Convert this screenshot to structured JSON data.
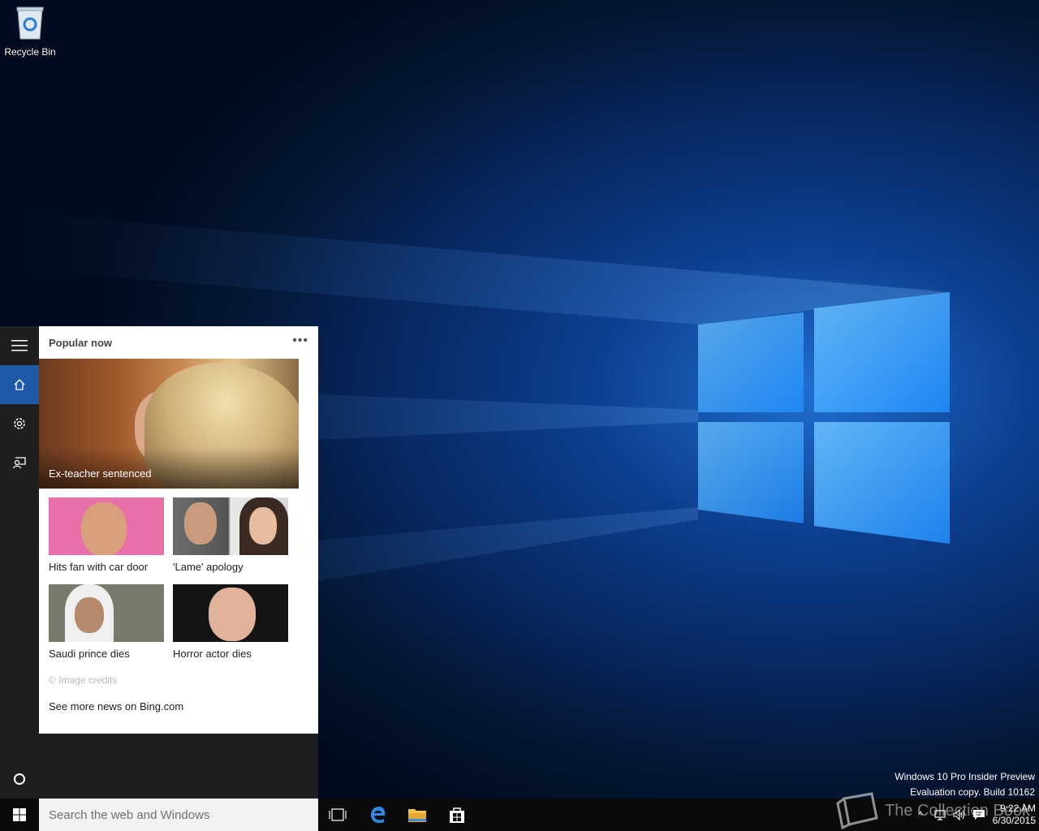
{
  "desktop": {
    "icons": [
      {
        "label": "Recycle Bin",
        "icon": "recycle-bin-icon"
      }
    ],
    "watermark": {
      "line1": "Windows 10 Pro Insider Preview",
      "line2": "Evaluation copy. Build 10162"
    },
    "overlay_logo_text": "The Collection Book"
  },
  "cortana": {
    "rail": [
      {
        "name": "menu",
        "icon": "hamburger-icon"
      },
      {
        "name": "home",
        "icon": "home-icon",
        "active": true
      },
      {
        "name": "settings",
        "icon": "gear-icon"
      },
      {
        "name": "feedback",
        "icon": "feedback-icon"
      },
      {
        "name": "cortana",
        "icon": "cortana-circle-icon"
      }
    ],
    "card": {
      "title": "Popular now",
      "more_icon": "more-dots-icon",
      "hero_caption": "Ex-teacher sentenced",
      "items": [
        {
          "caption": "Hits fan with car door"
        },
        {
          "caption": "'Lame' apology"
        },
        {
          "caption": "Saudi prince dies"
        },
        {
          "caption": "Horror actor dies"
        }
      ],
      "credits": "© Image credits",
      "see_more": "See more news on Bing.com"
    }
  },
  "taskbar": {
    "search_placeholder": "Search the web and Windows",
    "pinned": [
      {
        "name": "task-view",
        "icon": "task-view-icon"
      },
      {
        "name": "edge",
        "icon": "edge-icon"
      },
      {
        "name": "file-explorer",
        "icon": "folder-icon"
      },
      {
        "name": "store",
        "icon": "store-icon"
      }
    ],
    "clock": {
      "time": "9:22 AM",
      "date": "6/30/2015"
    },
    "accent": "#1e5aa8"
  }
}
